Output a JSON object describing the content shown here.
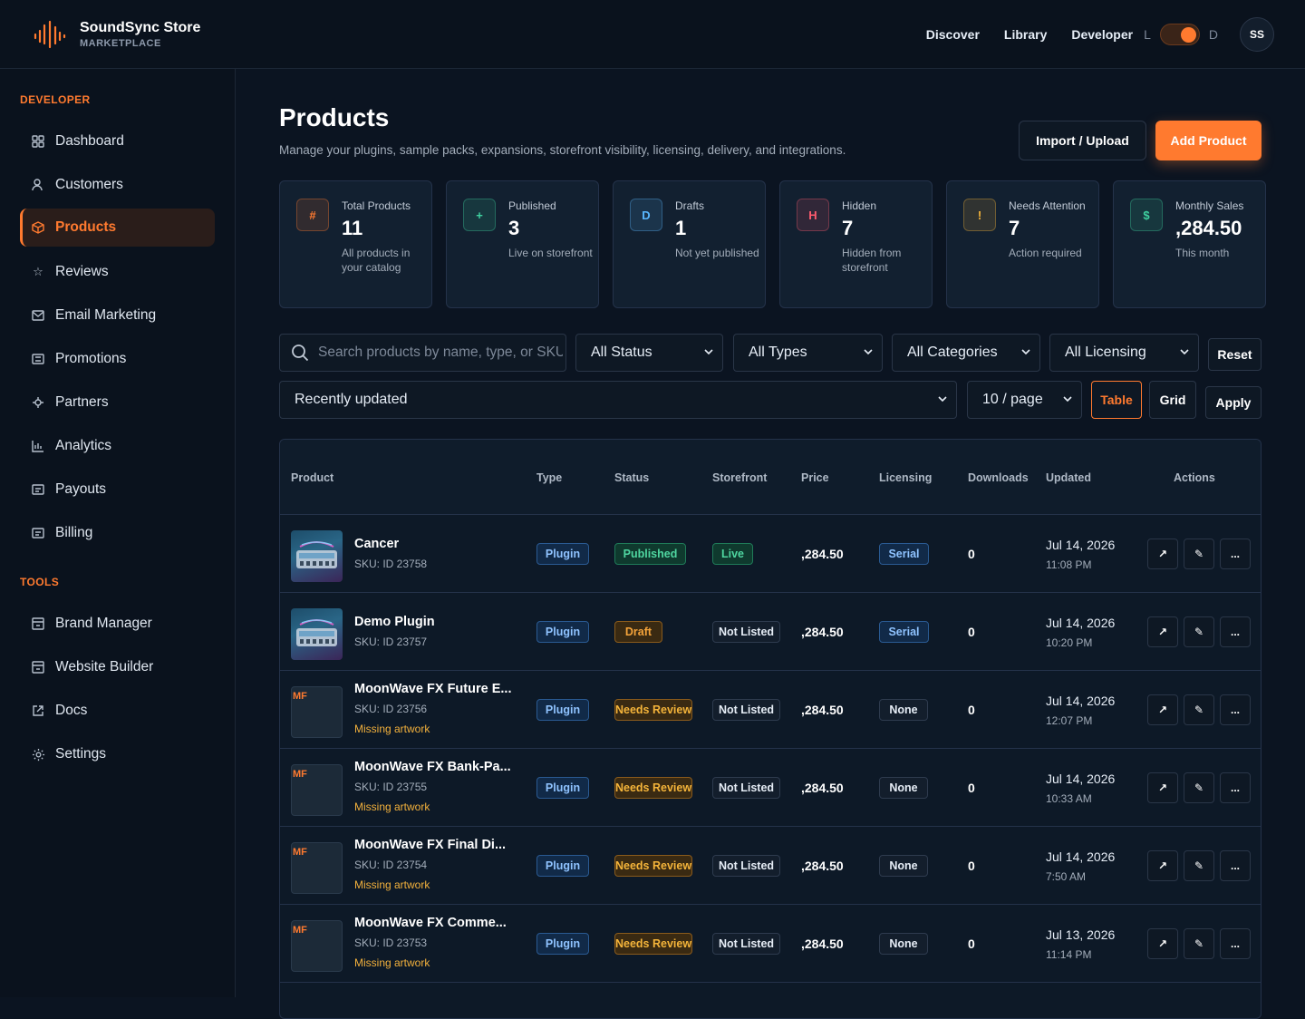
{
  "brand": {
    "name": "SoundSync Store",
    "sub": "MARKETPLACE"
  },
  "topnav": {
    "discover": "Discover",
    "library": "Library",
    "developer": "Developer",
    "mode_light": "L",
    "mode_dark": "D",
    "avatar": "SS"
  },
  "sidebar": {
    "section_developer": "DEVELOPER",
    "section_tools": "TOOLS",
    "items": [
      {
        "label": "Dashboard",
        "icon": "grid-icon"
      },
      {
        "label": "Customers",
        "icon": "user-icon"
      },
      {
        "label": "Products",
        "icon": "cube-icon",
        "active": true
      },
      {
        "label": "Reviews",
        "icon": "star-icon"
      },
      {
        "label": "Email Marketing",
        "icon": "mail-icon"
      },
      {
        "label": "Promotions",
        "icon": "ticket-icon"
      },
      {
        "label": "Partners",
        "icon": "puzzle-icon"
      },
      {
        "label": "Analytics",
        "icon": "chart-icon"
      },
      {
        "label": "Payouts",
        "icon": "doc-icon"
      },
      {
        "label": "Billing",
        "icon": "doc-icon"
      }
    ],
    "tools": [
      {
        "label": "Brand Manager",
        "icon": "building-icon"
      },
      {
        "label": "Website Builder",
        "icon": "building-icon"
      },
      {
        "label": "Docs",
        "icon": "external-link-icon"
      },
      {
        "label": "Settings",
        "icon": "gear-icon"
      }
    ]
  },
  "page": {
    "title": "Products",
    "subtitle": "Manage your plugins, sample packs, expansions, storefront visibility, licensing, delivery, and integrations.",
    "import_label": "Import / Upload",
    "add_label": "Add Product"
  },
  "stats": [
    {
      "icon": "#",
      "label": "Total Products",
      "value": "11",
      "desc": "All products in your catalog",
      "color": "#ff7a2f"
    },
    {
      "icon": "+",
      "label": "Published",
      "value": "3",
      "desc": "Live on storefront",
      "color": "#3fd1a0"
    },
    {
      "icon": "D",
      "label": "Drafts",
      "value": "1",
      "desc": "Not yet published",
      "color": "#5ab8ff"
    },
    {
      "icon": "H",
      "label": "Hidden",
      "value": "7",
      "desc": "Hidden from storefront",
      "color": "#ff5b6e"
    },
    {
      "icon": "!",
      "label": "Needs Attention",
      "value": "7",
      "desc": "Action required",
      "color": "#f4b43a"
    },
    {
      "icon": "$",
      "label": "Monthly Sales",
      "value": ",284.50",
      "desc": "This month",
      "color": "#3fd1a0"
    }
  ],
  "filters": {
    "search_placeholder": "Search products by name, type, or SKU",
    "status": "All Status",
    "types": "All Types",
    "categories": "All Categories",
    "licensing": "All Licensing",
    "reset": "Reset",
    "sort": "Recently updated",
    "per_page": "10 / page",
    "table": "Table",
    "grid": "Grid",
    "apply": "Apply"
  },
  "table": {
    "columns": [
      "Product",
      "Type",
      "Status",
      "Storefront",
      "Price",
      "Licensing",
      "Downloads",
      "Updated",
      "Actions"
    ],
    "rows": [
      {
        "thumb": "plugin",
        "name": "Cancer",
        "sku": "SKU: ID 23758",
        "warn": "",
        "type": "Plugin",
        "status": "Published",
        "storefront": "Live",
        "price": ",284.50",
        "licensing": "Serial",
        "downloads": "0",
        "date": "Jul 14, 2026",
        "time": "11:08 PM"
      },
      {
        "thumb": "plugin",
        "name": "Demo Plugin",
        "sku": "SKU: ID 23757",
        "warn": "",
        "type": "Plugin",
        "status": "Draft",
        "storefront": "Not Listed",
        "price": ",284.50",
        "licensing": "Serial",
        "downloads": "0",
        "date": "Jul 14, 2026",
        "time": "10:20 PM"
      },
      {
        "thumb": "MF",
        "name": "MoonWave FX Future E...",
        "sku": "SKU: ID 23756",
        "warn": "Missing artwork",
        "type": "Plugin",
        "status": "Needs Review",
        "storefront": "Not Listed",
        "price": ",284.50",
        "licensing": "None",
        "downloads": "0",
        "date": "Jul 14, 2026",
        "time": "12:07 PM"
      },
      {
        "thumb": "MF",
        "name": "MoonWave FX Bank-Pa...",
        "sku": "SKU: ID 23755",
        "warn": "Missing artwork",
        "type": "Plugin",
        "status": "Needs Review",
        "storefront": "Not Listed",
        "price": ",284.50",
        "licensing": "None",
        "downloads": "0",
        "date": "Jul 14, 2026",
        "time": "10:33 AM"
      },
      {
        "thumb": "MF",
        "name": "MoonWave FX Final Di...",
        "sku": "SKU: ID 23754",
        "warn": "Missing artwork",
        "type": "Plugin",
        "status": "Needs Review",
        "storefront": "Not Listed",
        "price": ",284.50",
        "licensing": "None",
        "downloads": "0",
        "date": "Jul 14, 2026",
        "time": "7:50 AM"
      },
      {
        "thumb": "MF",
        "name": "MoonWave FX Comme...",
        "sku": "SKU: ID 23753",
        "warn": "Missing artwork",
        "type": "Plugin",
        "status": "Needs Review",
        "storefront": "Not Listed",
        "price": ",284.50",
        "licensing": "None",
        "downloads": "0",
        "date": "Jul 13, 2026",
        "time": "11:14 PM"
      }
    ],
    "actions": {
      "open": "↗",
      "edit": "✎",
      "more": "..."
    }
  }
}
